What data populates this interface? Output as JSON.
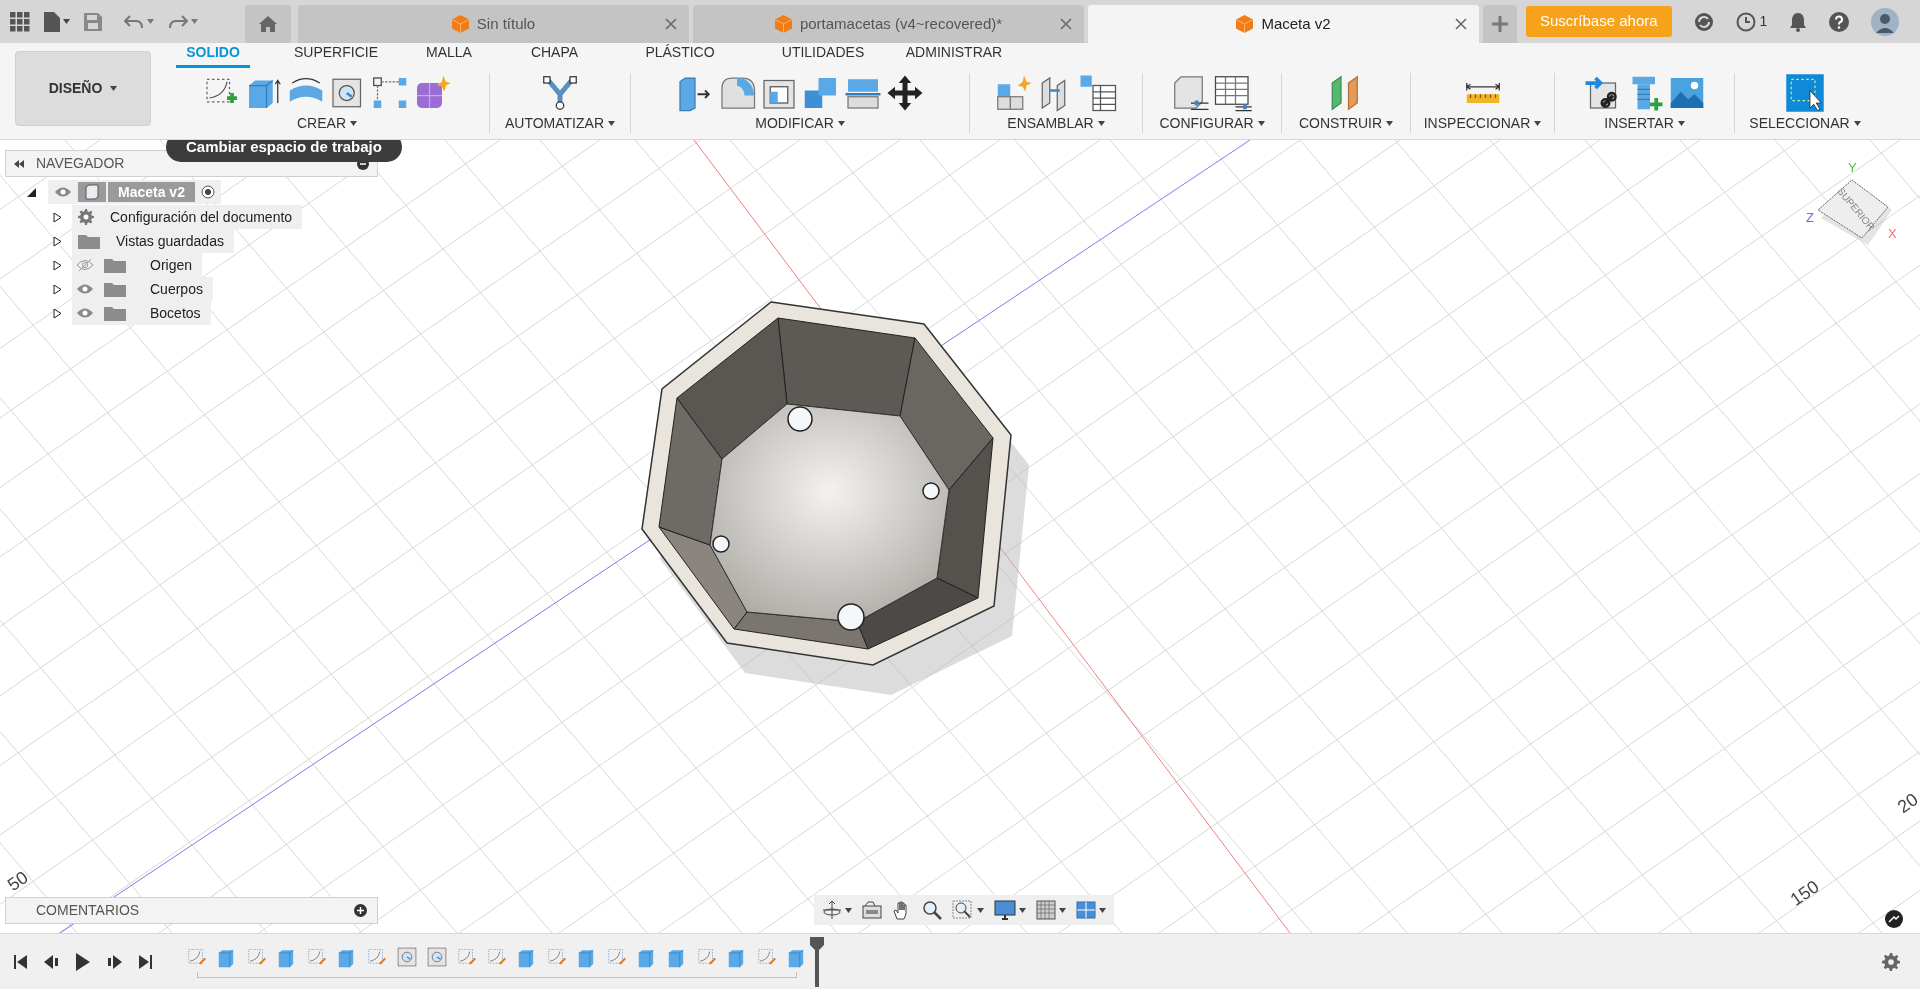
{
  "top_bar": {
    "tabs": [
      {
        "title": "Sin título",
        "selected": false
      },
      {
        "title": "portamacetas (v4~recovered)*",
        "selected": false
      },
      {
        "title": "Maceta v2",
        "selected": true
      }
    ],
    "subscribe_button": "Suscríbase ahora",
    "jobs_count": "1"
  },
  "toolbar": {
    "workspace": "DISEÑO",
    "tabs": [
      {
        "label": "SOLIDO",
        "selected": true
      },
      {
        "label": "SUPERFICIE",
        "selected": false
      },
      {
        "label": "MALLA",
        "selected": false
      },
      {
        "label": "CHAPA",
        "selected": false
      },
      {
        "label": "PLÁSTICO",
        "selected": false
      },
      {
        "label": "UTILIDADES",
        "selected": false
      },
      {
        "label": "ADMINISTRAR",
        "selected": false
      }
    ],
    "groups": [
      {
        "label": "CREAR"
      },
      {
        "label": "AUTOMATIZAR"
      },
      {
        "label": "MODIFICAR"
      },
      {
        "label": "ENSAMBLAR"
      },
      {
        "label": "CONFIGURAR"
      },
      {
        "label": "CONSTRUIR"
      },
      {
        "label": "INSPECCIONAR"
      },
      {
        "label": "INSERTAR"
      },
      {
        "label": "SELECCIONAR"
      }
    ]
  },
  "tooltip": "Cambiar espacio de trabajo",
  "browser": {
    "title": "NAVEGADOR",
    "root": {
      "label": "Maceta v2",
      "expanded": true,
      "visible": true,
      "children": [
        {
          "label": "Configuración del documento",
          "kind": "settings",
          "expanded": false
        },
        {
          "label": "Vistas guardadas",
          "kind": "folder",
          "expanded": false
        },
        {
          "label": "Origen",
          "kind": "folder",
          "expanded": false,
          "visible": false
        },
        {
          "label": "Cuerpos",
          "kind": "folder",
          "expanded": false,
          "visible": true
        },
        {
          "label": "Bocetos",
          "kind": "folder",
          "expanded": false,
          "visible": true
        }
      ]
    }
  },
  "viewport": {
    "axis_labels": [
      "50",
      "150",
      "20"
    ],
    "view_cube": {
      "face": "SUPERIOR",
      "axes": [
        "X",
        "Y",
        "Z"
      ]
    }
  },
  "comments": {
    "title": "COMENTARIOS"
  },
  "timeline": {
    "features": [
      {
        "kind": "sketch"
      },
      {
        "kind": "extrude"
      },
      {
        "kind": "sketch"
      },
      {
        "kind": "extrude"
      },
      {
        "kind": "sketch"
      },
      {
        "kind": "extrude"
      },
      {
        "kind": "sketch"
      },
      {
        "kind": "hole"
      },
      {
        "kind": "hole"
      },
      {
        "kind": "sketch"
      },
      {
        "kind": "sketch"
      },
      {
        "kind": "extrude"
      },
      {
        "kind": "sketch"
      },
      {
        "kind": "extrude"
      },
      {
        "kind": "sketch"
      },
      {
        "kind": "extrude"
      },
      {
        "kind": "extrude"
      },
      {
        "kind": "sketch"
      },
      {
        "kind": "extrude"
      },
      {
        "kind": "sketch"
      },
      {
        "kind": "extrude"
      }
    ]
  }
}
